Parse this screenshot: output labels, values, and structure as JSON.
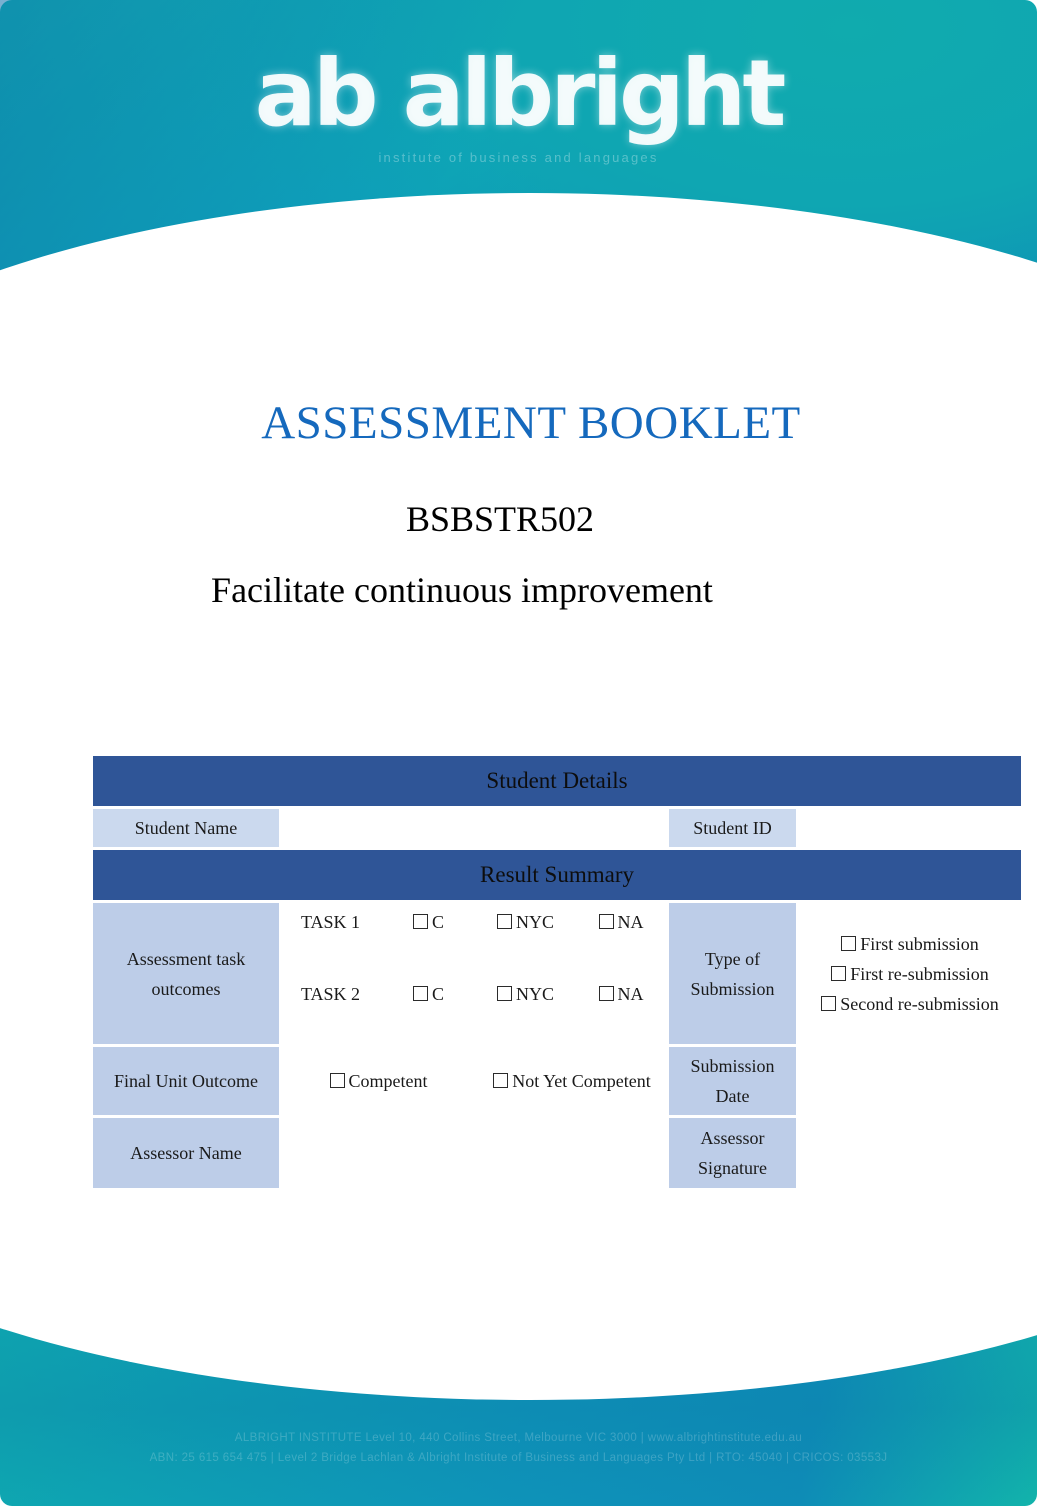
{
  "header": {
    "logo_text": "ab albright",
    "logo_tagline": "institute of business and languages",
    "logo_icon": "albright-logo-icon"
  },
  "title": {
    "document_title": "ASSESSMENT BOOKLET",
    "unit_code": "BSBSTR502",
    "unit_name": "Facilitate continuous improvement",
    "title_color": "#1569bd"
  },
  "table": {
    "student_details_header": "Student Details",
    "result_summary_header": "Result Summary",
    "student_name_label": "Student Name",
    "student_name_value": "",
    "student_id_label": "Student ID",
    "student_id_value": "",
    "assessment_outcomes_label": "Assessment task outcomes",
    "task1_label": "TASK 1",
    "task2_label": "TASK 2",
    "outcome_c": "C",
    "outcome_nyc": "NYC",
    "outcome_na": "NA",
    "type_of_submission_label": "Type of Submission",
    "submission_first": "First submission",
    "submission_first_re": "First re-submission",
    "submission_second_re": "Second re-submission",
    "final_unit_outcome_label": "Final Unit Outcome",
    "final_competent": "Competent",
    "final_not_yet_competent": "Not Yet Competent",
    "submission_date_label": "Submission Date",
    "submission_date_value": "",
    "assessor_name_label": "Assessor Name",
    "assessor_name_value": "",
    "assessor_signature_label": "Assessor Signature",
    "assessor_signature_value": "",
    "header_color": "#2f5597",
    "label_color": "#bdcde8"
  },
  "footer": {
    "line1": "ALBRIGHT INSTITUTE Level 10, 440 Collins Street, Melbourne VIC 3000  |  www.albrightinstitute.edu.au",
    "line2": "ABN: 25 615 654 475  |  Level 2 Bridge Lachlan & Albright Institute of Business and Languages Pty Ltd  |  RTO: 45040  |  CRICOS: 03553J"
  }
}
